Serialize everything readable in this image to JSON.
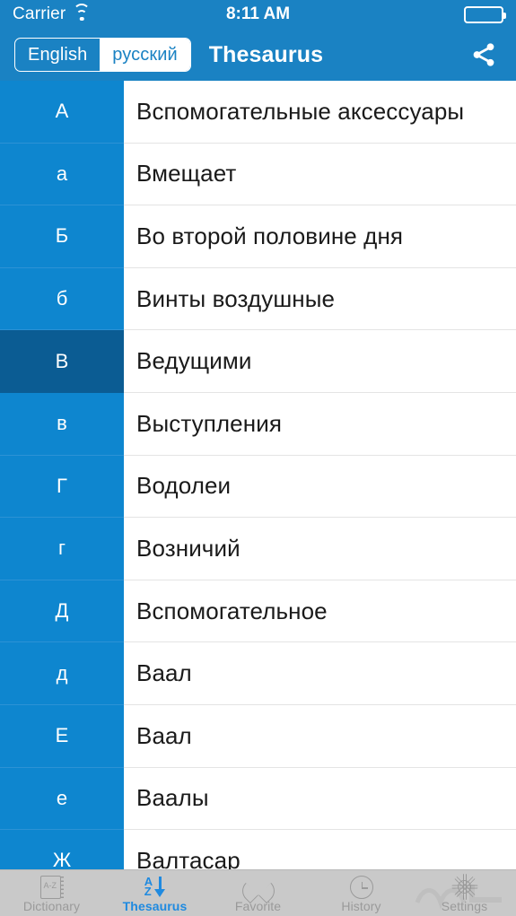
{
  "status_bar": {
    "carrier": "Carrier",
    "wifi_icon": "wifi-icon",
    "time": "8:11 AM",
    "battery_icon": "battery-full-icon"
  },
  "nav_bar": {
    "language_segmented": {
      "options": [
        "English",
        "русский"
      ],
      "selected": "русский"
    },
    "title": "Thesaurus",
    "share_icon": "share-icon"
  },
  "list": {
    "selected_letter": "В",
    "rows": [
      {
        "letter": "А",
        "word": "Вспомогательные аксессуары",
        "selected": false
      },
      {
        "letter": "а",
        "word": "Вмещает",
        "selected": false
      },
      {
        "letter": "Б",
        "word": "Во второй половине дня",
        "selected": false
      },
      {
        "letter": "б",
        "word": "Винты воздушные",
        "selected": false
      },
      {
        "letter": "В",
        "word": "Ведущими",
        "selected": true
      },
      {
        "letter": "в",
        "word": "Выступления",
        "selected": false
      },
      {
        "letter": "Г",
        "word": "Водолеи",
        "selected": false
      },
      {
        "letter": "г",
        "word": "Возничий",
        "selected": false
      },
      {
        "letter": "Д",
        "word": "Вспомогательное",
        "selected": false
      },
      {
        "letter": "д",
        "word": "Ваал",
        "selected": false
      },
      {
        "letter": "Е",
        "word": "Ваал",
        "selected": false
      },
      {
        "letter": "е",
        "word": "Ваалы",
        "selected": false
      },
      {
        "letter": "Ж",
        "word": "Валтасар",
        "selected": false
      }
    ]
  },
  "tab_bar": {
    "selected": "Thesaurus",
    "tabs": [
      {
        "label": "Dictionary",
        "icon": "book-az-icon",
        "active": false
      },
      {
        "label": "Thesaurus",
        "icon": "sort-a-z-icon",
        "active": true
      },
      {
        "label": "Favorite",
        "icon": "heart-icon",
        "active": false
      },
      {
        "label": "History",
        "icon": "clock-icon",
        "active": false
      },
      {
        "label": "Settings",
        "icon": "gear-icon",
        "active": false
      }
    ]
  },
  "colors": {
    "nav_blue": "#1A82C3",
    "sidebar_blue": "#0E86CF",
    "selected_blue": "#0B5C93",
    "tab_active": "#1f8ae0",
    "tab_bar_bg": "#c9c9c9"
  }
}
